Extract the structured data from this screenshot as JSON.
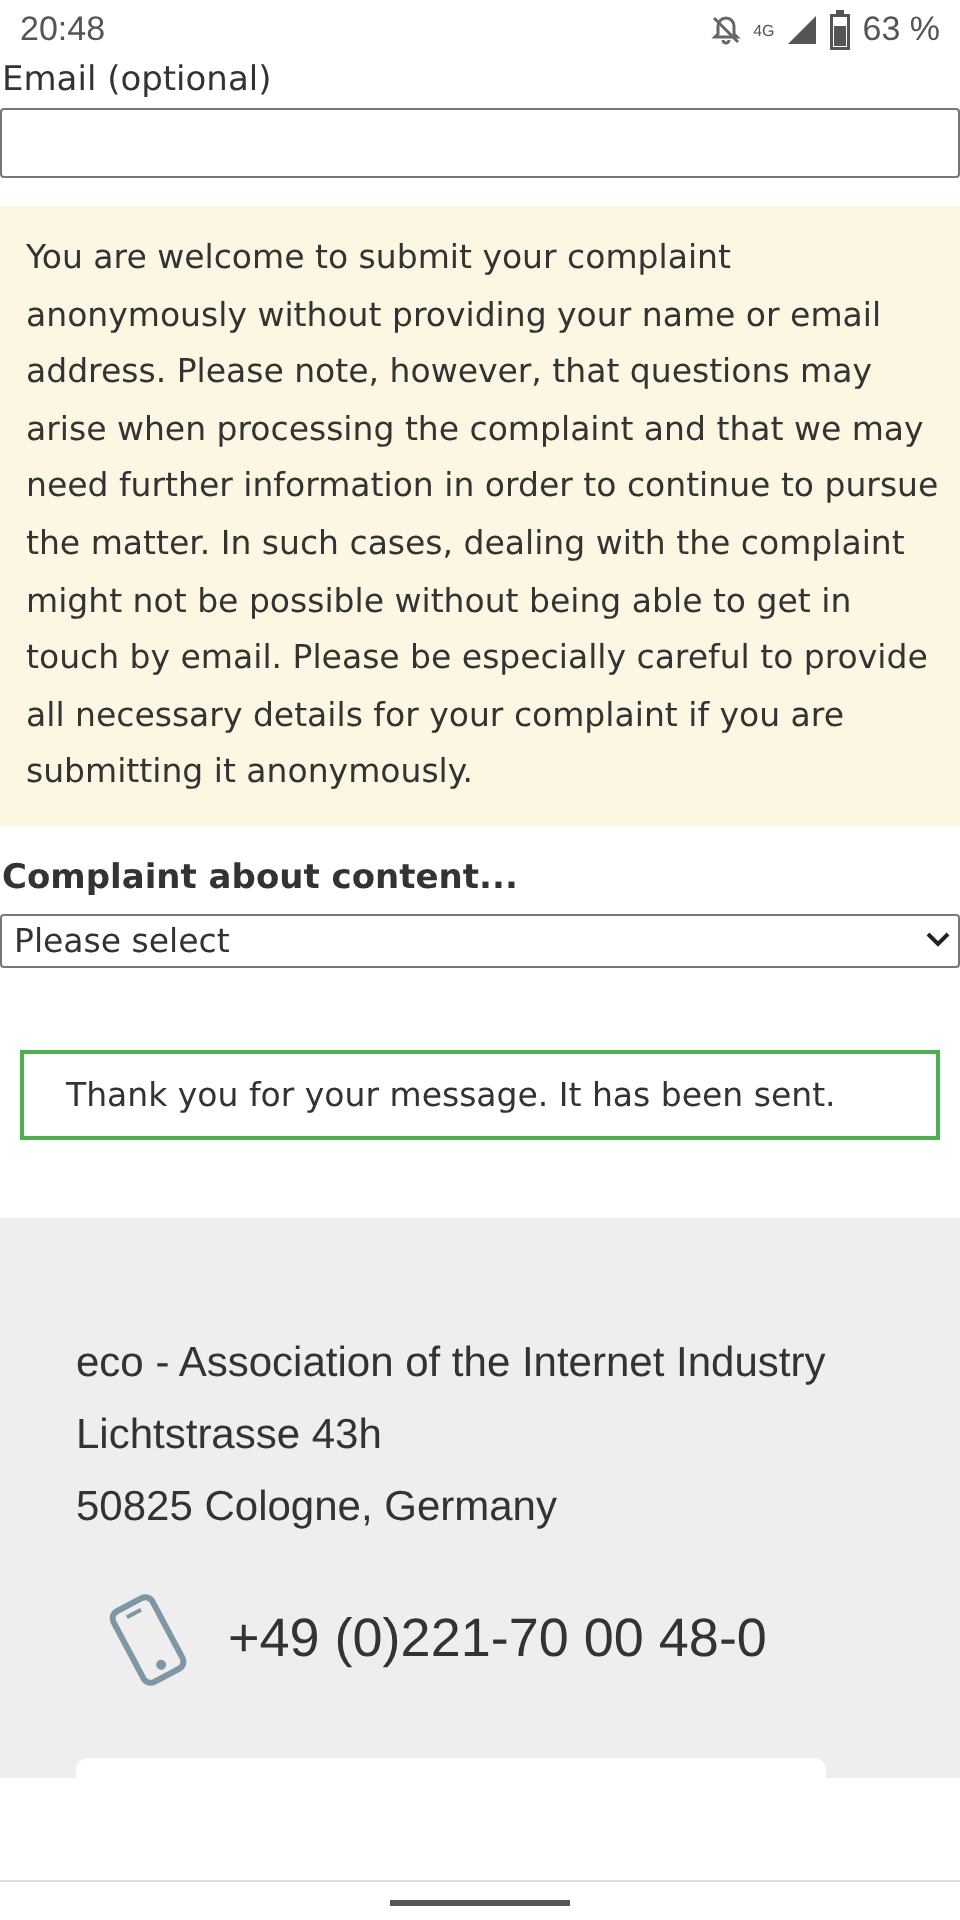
{
  "status_bar": {
    "time": "20:48",
    "network": "4G",
    "battery": "63 %"
  },
  "form": {
    "email_label": "Email (optional)",
    "notice": "You are welcome to submit your complaint anonymously without providing your name or email address. Please note, however, that questions may arise when processing the complaint and that we may need further information in order to continue to pursue the matter. In such cases, dealing with the complaint might not be possible without being able to get in touch by email. Please be especially careful to provide all necessary details for your complaint if you are submitting it anonymously.",
    "complaint_label": "Complaint about content...",
    "complaint_select": {
      "value": "Please select"
    },
    "success_message": "Thank you for your message. It has been sent."
  },
  "footer": {
    "address_lines": [
      "eco - Association of the Internet Industry",
      "Lichtstrasse 43h",
      "50825 Cologne, Germany"
    ],
    "phone": "+49 (0)221-70 00 48-0"
  }
}
